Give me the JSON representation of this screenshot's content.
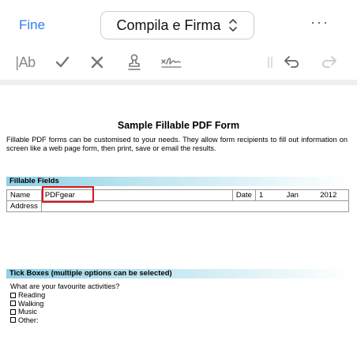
{
  "toolbar": {
    "done_label": "Fine",
    "mode_label": "Compila e Firma",
    "more_label": "···",
    "text_tool_label": "|Ab",
    "tools": [
      "text-icon",
      "checkmark-icon",
      "cross-icon",
      "stamp-icon",
      "signature-icon",
      "undo-icon",
      "redo-icon"
    ]
  },
  "document": {
    "title": "Sample Fillable PDF Form",
    "intro": "Fillable PDF forms can be customised to your needs. They allow form recipients to fill out information on screen like a web page form, then print, save or email the results.",
    "fillable_section": {
      "heading": "Fillable Fields",
      "name_label": "Name",
      "name_value": "PDFgear",
      "date_label": "Date",
      "date_day": "1",
      "date_month": "Jan",
      "date_year": "2012",
      "address_label": "Address"
    },
    "tick_section": {
      "heading": "Tick Boxes (multiple options can be selected)",
      "question": "What are your favourite activities?",
      "options": [
        "Reading",
        "Walking",
        "Music",
        "Other:"
      ]
    }
  },
  "colors": {
    "accent": "#2f7cf6",
    "focus_outline": "#d9141a",
    "section_bar": "#8fd0e4"
  }
}
